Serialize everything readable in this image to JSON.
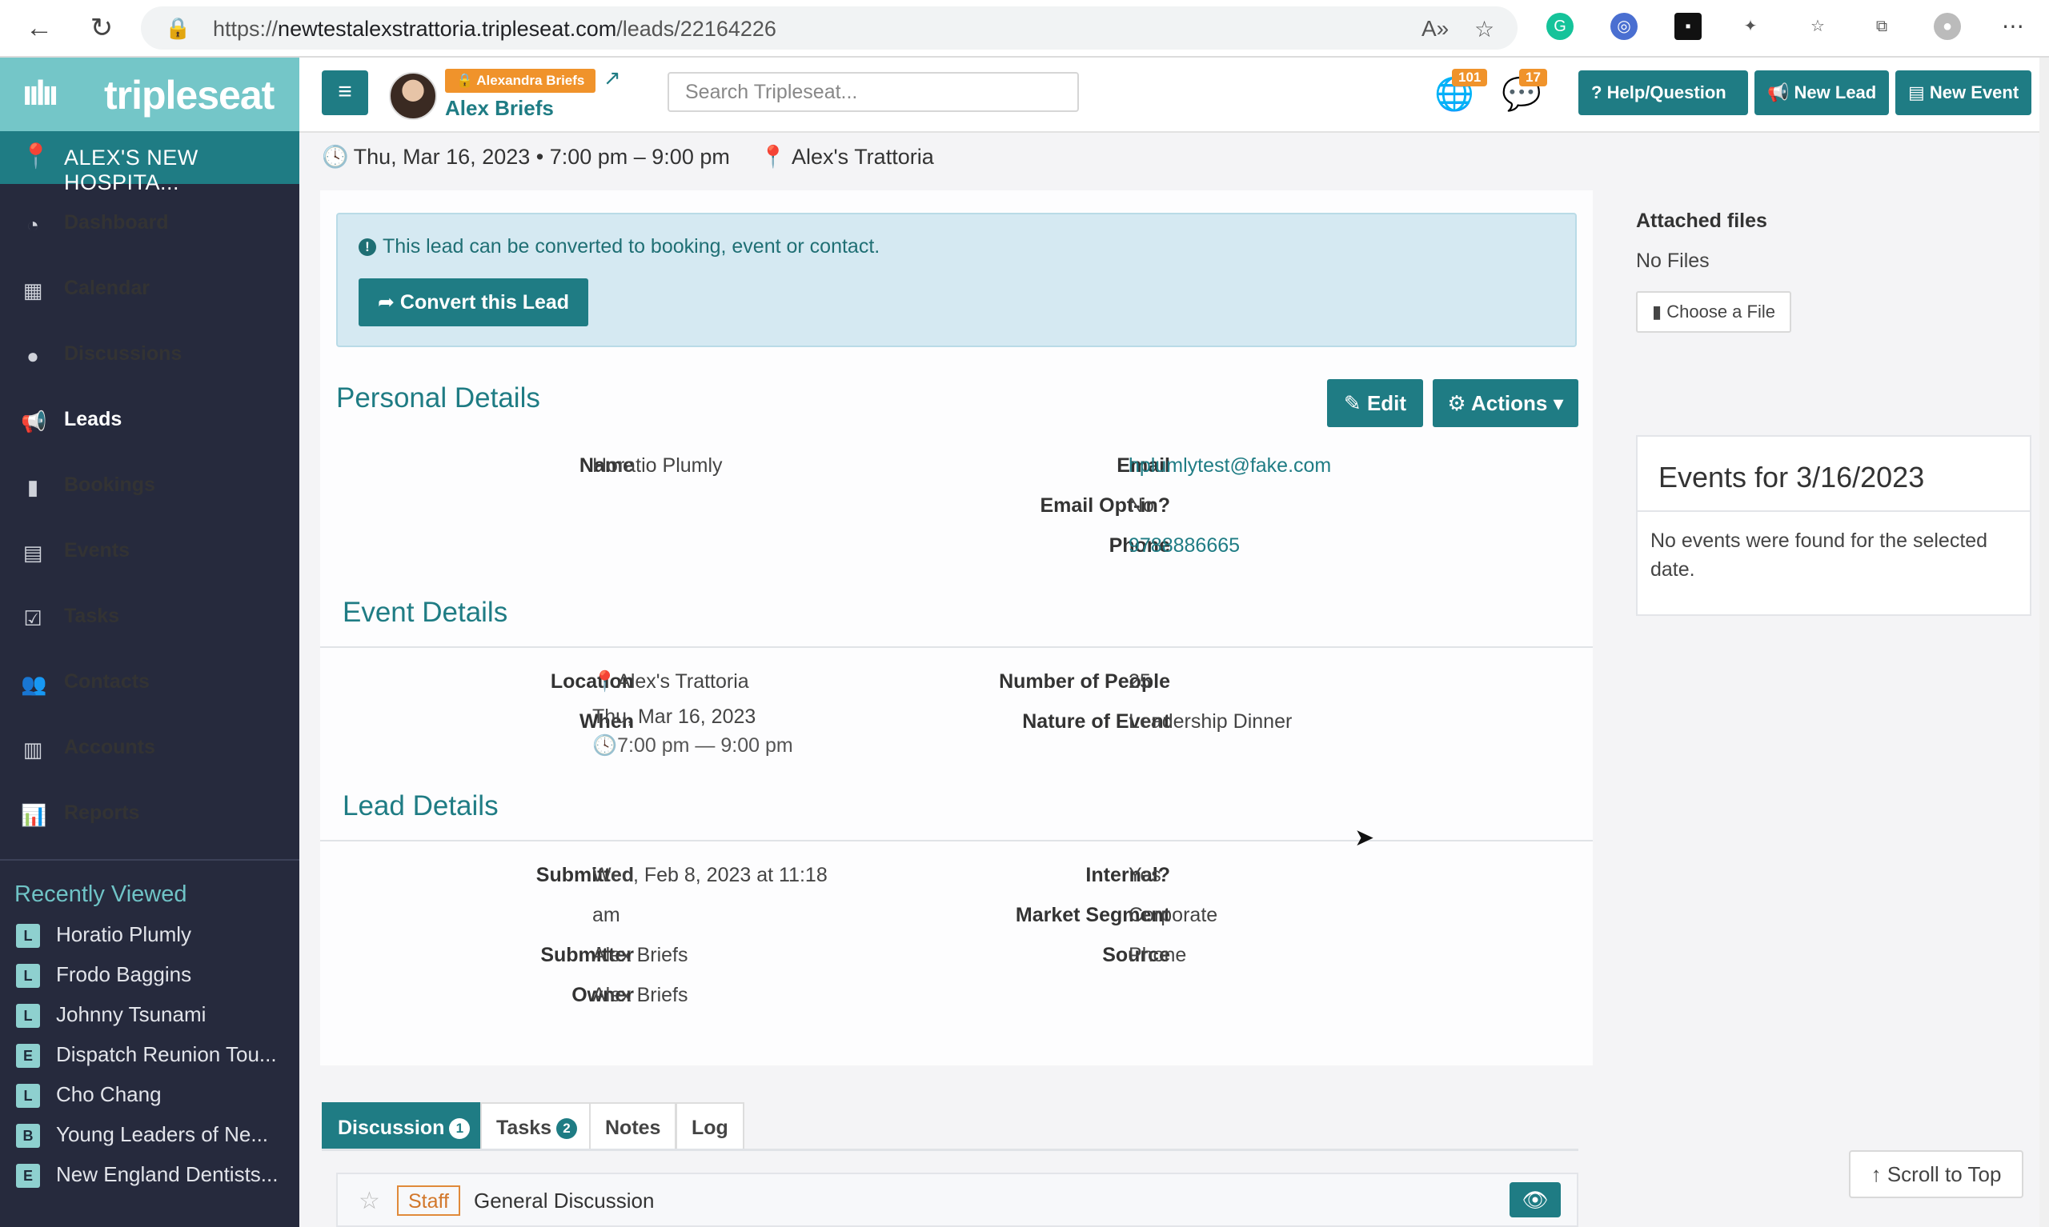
{
  "browser": {
    "url_prefix": "https://",
    "url_host": "newtestalexstrattoria.tripleseat.com",
    "url_path": "/leads/22164226"
  },
  "sidebar": {
    "logo": "tripleseat",
    "location": "ALEX'S NEW HOSPITA...",
    "items": [
      {
        "label": "Dashboard",
        "icon": "dashboard-icon",
        "glyph": "◔"
      },
      {
        "label": "Calendar",
        "icon": "calendar-icon",
        "glyph": "▦"
      },
      {
        "label": "Discussions",
        "icon": "comment-icon",
        "glyph": "●"
      },
      {
        "label": "Leads",
        "icon": "megaphone-icon",
        "glyph": "📢"
      },
      {
        "label": "Bookings",
        "icon": "bookmark-icon",
        "glyph": "▮"
      },
      {
        "label": "Events",
        "icon": "book-icon",
        "glyph": "▤"
      },
      {
        "label": "Tasks",
        "icon": "checkbox-icon",
        "glyph": "☑"
      },
      {
        "label": "Contacts",
        "icon": "users-icon",
        "glyph": "👥"
      },
      {
        "label": "Accounts",
        "icon": "building-icon",
        "glyph": "▥"
      },
      {
        "label": "Reports",
        "icon": "bar-chart-icon",
        "glyph": "📊"
      }
    ],
    "active": "Leads",
    "recent_title": "Recently Viewed",
    "recent": [
      {
        "badge": "L",
        "label": "Horatio Plumly"
      },
      {
        "badge": "L",
        "label": "Frodo Baggins"
      },
      {
        "badge": "L",
        "label": "Johnny Tsunami"
      },
      {
        "badge": "E",
        "label": "Dispatch Reunion Tou..."
      },
      {
        "badge": "L",
        "label": "Cho Chang"
      },
      {
        "badge": "B",
        "label": "Young Leaders of Ne..."
      },
      {
        "badge": "E",
        "label": "New England Dentists..."
      }
    ]
  },
  "topbar": {
    "impersonate_label": "Alexandra Briefs",
    "user_name": "Alex Briefs",
    "search_placeholder": "Search Tripleseat...",
    "globe_count": "101",
    "chat_count": "17",
    "help_label": "Help/Question",
    "new_lead_label": "New Lead",
    "new_event_label": "New Event"
  },
  "header": {
    "datetime": "Thu, Mar 16, 2023 • 7:00 pm – 9:00 pm",
    "location": "Alex's Trattoria"
  },
  "alert": {
    "message": "This lead can be converted to booking, event or contact.",
    "convert_label": "Convert this Lead"
  },
  "personal": {
    "title": "Personal Details",
    "edit_label": "Edit",
    "actions_label": "Actions",
    "name_label": "Name",
    "name": "Horatio Plumly",
    "email_label": "Email",
    "email": "hplumlytest@fake.com",
    "optin_label": "Email Opt-in?",
    "optin": "No",
    "phone_label": "Phone",
    "phone": "9788886665"
  },
  "event": {
    "title": "Event Details",
    "location_label": "Location",
    "location": "Alex's Trattoria",
    "when_label": "When",
    "when_date": "Thu, Mar 16, 2023",
    "when_time": "7:00 pm — 9:00 pm",
    "people_label": "Number of People",
    "people": "25",
    "nature_label": "Nature of Event",
    "nature": "Leadership Dinner"
  },
  "lead": {
    "title": "Lead Details",
    "submitted_label": "Submitted",
    "submitted_line1": "Wed, Feb 8, 2023 at 11:18",
    "submitted_line2": "am",
    "submitter_label": "Submitter",
    "submitter": "Alex Briefs",
    "owner_label": "Owner",
    "owner": "Alex Briefs",
    "internal_label": "Internal?",
    "internal": "Yes",
    "segment_label": "Market Segment",
    "segment": "Corporate",
    "source_label": "Source",
    "source": "Phone"
  },
  "tabs": [
    {
      "label": "Discussion",
      "count": "1"
    },
    {
      "label": "Tasks",
      "count": "2"
    },
    {
      "label": "Notes",
      "count": ""
    },
    {
      "label": "Log",
      "count": ""
    }
  ],
  "discussion": {
    "tag": "Staff",
    "title": "General Discussion"
  },
  "files": {
    "title": "Attached files",
    "empty": "No Files",
    "choose_label": "Choose a File"
  },
  "events_panel": {
    "title": "Events for 3/16/2023",
    "empty": "No events were found for the selected date."
  },
  "scroll_top_label": "Scroll to Top",
  "colors": {
    "brand": "#1f7c84",
    "sidebar": "#262a3d",
    "logo_bar": "#74c6c8",
    "accent_orange": "#f0932b"
  }
}
